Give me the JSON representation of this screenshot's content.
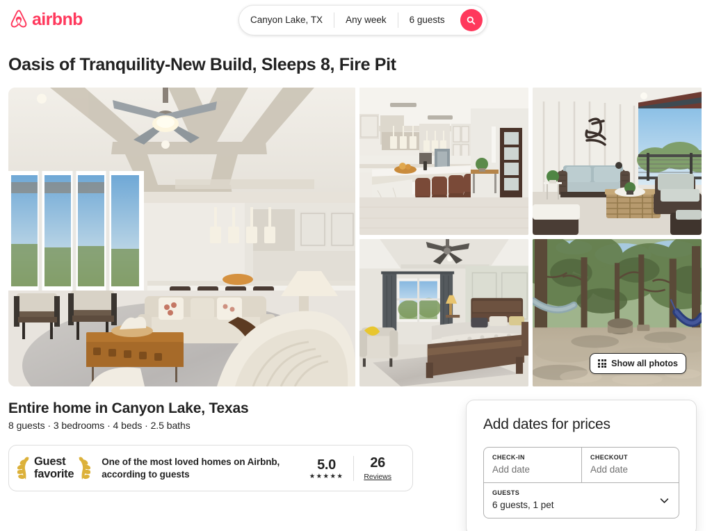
{
  "header": {
    "logo_text": "airbnb",
    "logo_icon": "airbnb-belo-icon",
    "logo_color": "#FF385C",
    "search": {
      "location": "Canyon Lake, TX",
      "dates": "Any week",
      "guests": "6 guests",
      "search_icon": "search-icon"
    }
  },
  "listing": {
    "title": "Oasis of Tranquility-New Build, Sleeps 8, Fire Pit",
    "home_type": "Entire home in Canyon Lake, Texas",
    "specs": "8 guests · 3 bedrooms · 4 beds · 2.5 baths"
  },
  "gallery": {
    "show_all_label": "Show all photos",
    "show_all_icon": "grid-icon",
    "photos": [
      {
        "name": "living-room-hero",
        "alt": "Living room with coffered ceiling, ceiling fan, sectional sofas and wood coffee table"
      },
      {
        "name": "kitchen",
        "alt": "Kitchen with marble island, brown leather barstools and dark front door"
      },
      {
        "name": "covered-patio",
        "alt": "Covered patio with wicker sofa, ottoman and hill country view"
      },
      {
        "name": "bedroom",
        "alt": "Bedroom with wood bed frame, gray curtains and yellow accent pillow"
      },
      {
        "name": "backyard-hammocks",
        "alt": "Wooded backyard with hammocks and fire pit"
      }
    ]
  },
  "guest_favorite": {
    "badge_label_line1": "Guest",
    "badge_label_line2": "favorite",
    "laurel_icon": "laurel-wreath-icon",
    "description": "One of the most loved homes on Airbnb, according to guests",
    "rating": "5.0",
    "stars": "★★★★★",
    "reviews_count": "26",
    "reviews_label": "Reviews"
  },
  "booking": {
    "title": "Add dates for prices",
    "checkin_label": "CHECK-IN",
    "checkin_value": "Add date",
    "checkout_label": "CHECKOUT",
    "checkout_value": "Add date",
    "guests_label": "GUESTS",
    "guests_value": "6 guests, 1 pet",
    "chevron_icon": "chevron-down-icon"
  }
}
